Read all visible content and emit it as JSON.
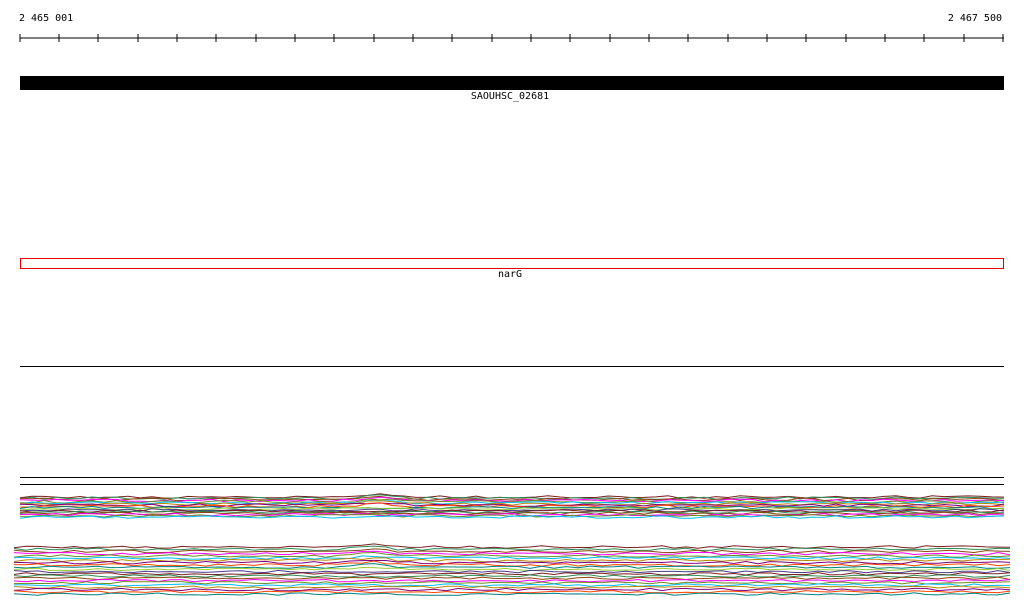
{
  "ruler": {
    "start_label": "2 465 001",
    "end_label": "2 467 500"
  },
  "features": [
    {
      "label": "SAOUHSC_02681",
      "style": "filled",
      "color": "#000000"
    },
    {
      "label": "narG",
      "style": "outline",
      "color": "#e60000"
    }
  ],
  "track_colors": [
    "#7a1f1f",
    "#2e8b57",
    "#8b4513",
    "#ff00ff",
    "#6b8e23",
    "#00bfff",
    "#b8860b",
    "#800080",
    "#ff4500",
    "#008080",
    "#9acd32",
    "#483d8b"
  ]
}
